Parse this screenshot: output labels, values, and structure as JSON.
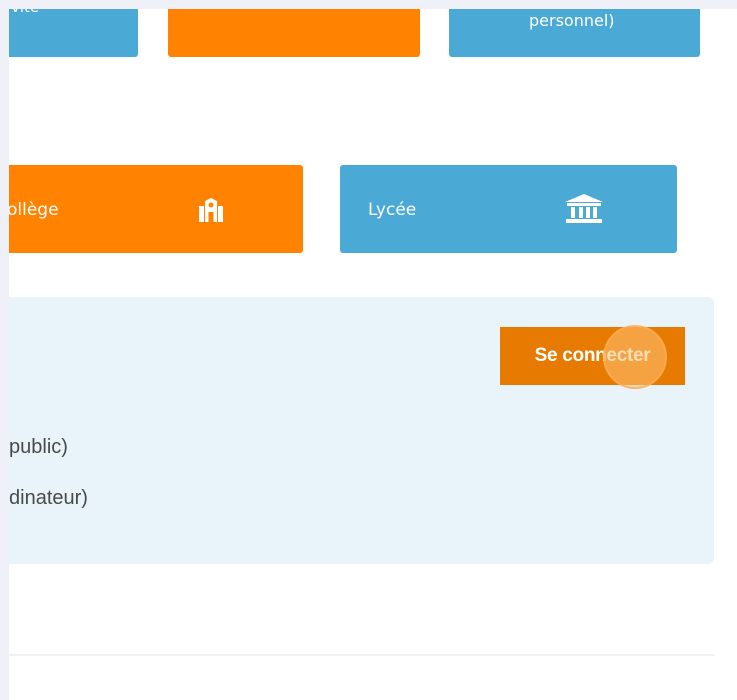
{
  "tiles": {
    "top_left": {
      "label": "vite",
      "color": "#4ba9d6"
    },
    "top_middle": {
      "label": "",
      "color": "#ff8300"
    },
    "top_right": {
      "label": "personnel)",
      "color": "#4ba9d6"
    },
    "college": {
      "label": "ollège",
      "icon": "school-building-icon",
      "color": "#ff8300"
    },
    "lycee": {
      "label": "Lycée",
      "icon": "institution-columns-icon",
      "color": "#4ba9d6"
    }
  },
  "login_panel": {
    "button_label": "Se connecter",
    "lines": [
      "public)",
      "dinateur)"
    ],
    "accent_color": "#e77a00"
  }
}
